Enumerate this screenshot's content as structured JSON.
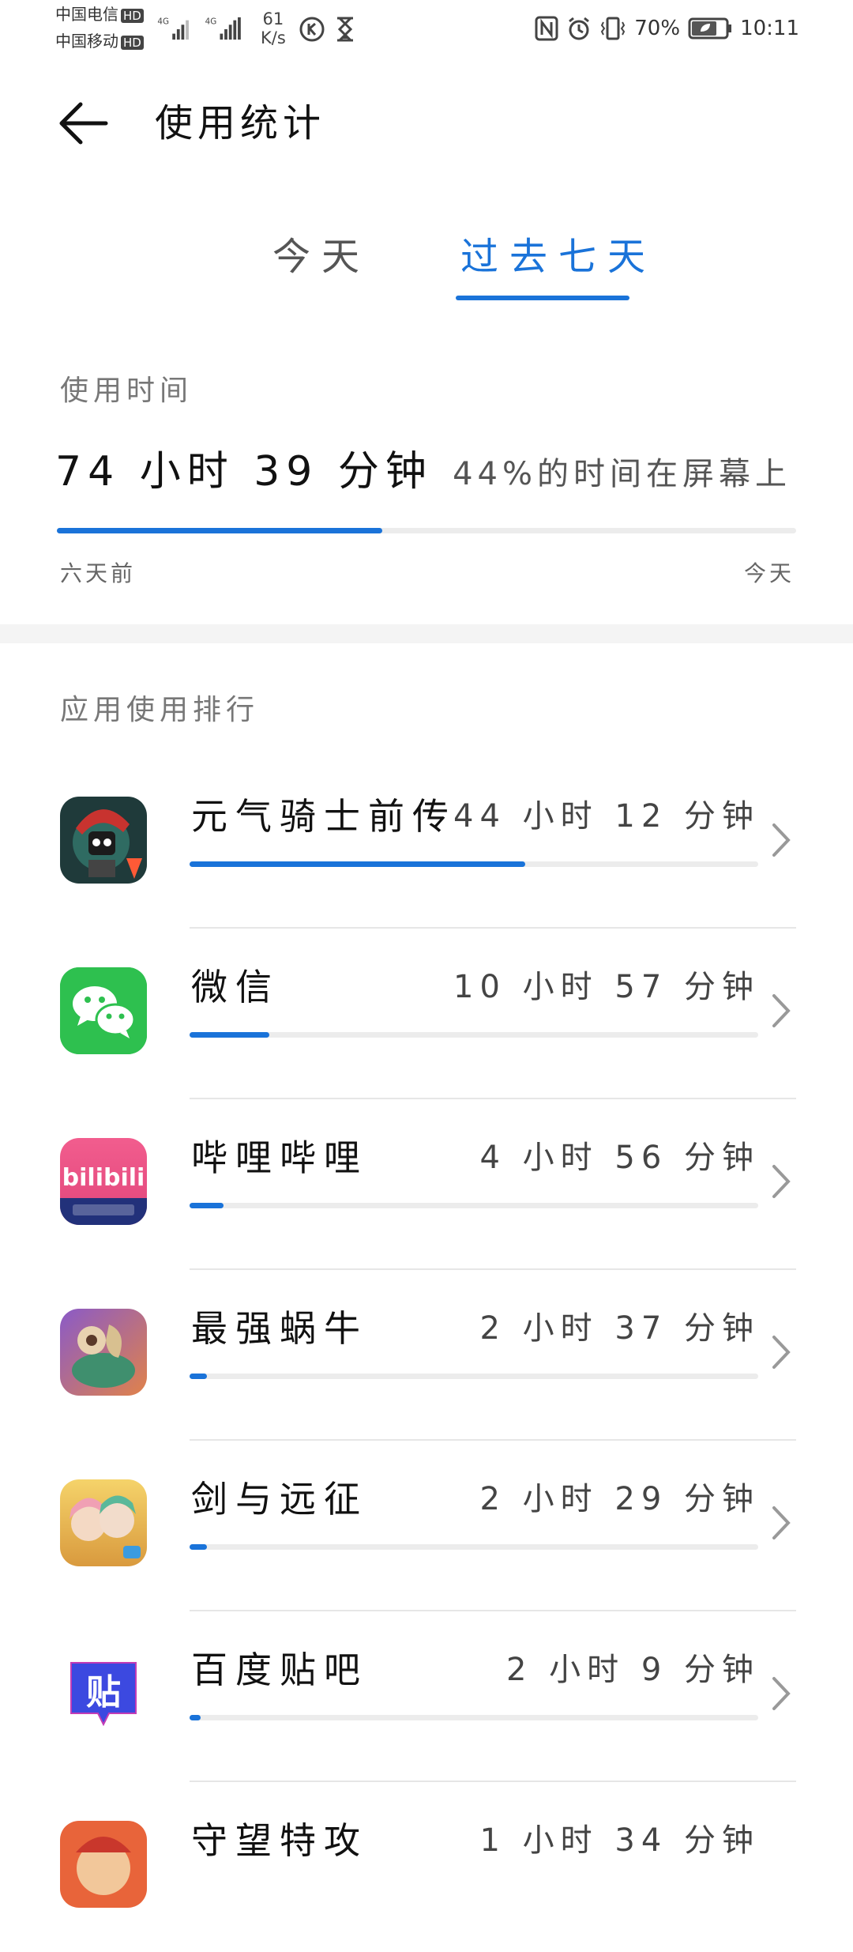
{
  "status_bar": {
    "carrier1": "中国电信",
    "carrier2": "中国移动",
    "hd": "HD",
    "net_type": "4G",
    "net_speed_value": "61",
    "net_speed_unit": "K/s",
    "battery": "70%",
    "time": "10:11"
  },
  "header": {
    "title": "使用统计"
  },
  "tabs": [
    {
      "label": "今天",
      "selected": false
    },
    {
      "label": "过去七天",
      "selected": true
    }
  ],
  "usage": {
    "label": "使用时间",
    "total": "74 小时 39 分钟",
    "screen_text": "44%的时间在屏幕上",
    "progress": 0.44,
    "axis_start": "六天前",
    "axis_end": "今天"
  },
  "ranking": {
    "title": "应用使用排行",
    "apps": [
      {
        "name": "元气骑士前传",
        "time": "44 小时 12 分钟",
        "progress": 0.59,
        "icon": "soul-knight-prequel-icon"
      },
      {
        "name": "微信",
        "time": "10 小时 57 分钟",
        "progress": 0.14,
        "icon": "wechat-icon"
      },
      {
        "name": "哔哩哔哩",
        "time": "4 小时 56 分钟",
        "progress": 0.06,
        "icon": "bilibili-icon"
      },
      {
        "name": "最强蜗牛",
        "time": "2 小时 37 分钟",
        "progress": 0.03,
        "icon": "super-snail-icon"
      },
      {
        "name": "剑与远征",
        "time": "2 小时 29 分钟",
        "progress": 0.03,
        "icon": "afk-arena-icon"
      },
      {
        "name": "百度贴吧",
        "time": "2 小时 9 分钟",
        "progress": 0.02,
        "icon": "baidu-tieba-icon"
      },
      {
        "name": "守望特攻",
        "time": "1 小时 34 分钟",
        "progress": 0.02,
        "icon": "game-icon"
      }
    ]
  },
  "colors": {
    "accent": "#1a73d9",
    "track": "#ececec",
    "wechat": "#2ec04f",
    "bilibili": "#f25d8e",
    "tieba": "#3c49e0"
  }
}
